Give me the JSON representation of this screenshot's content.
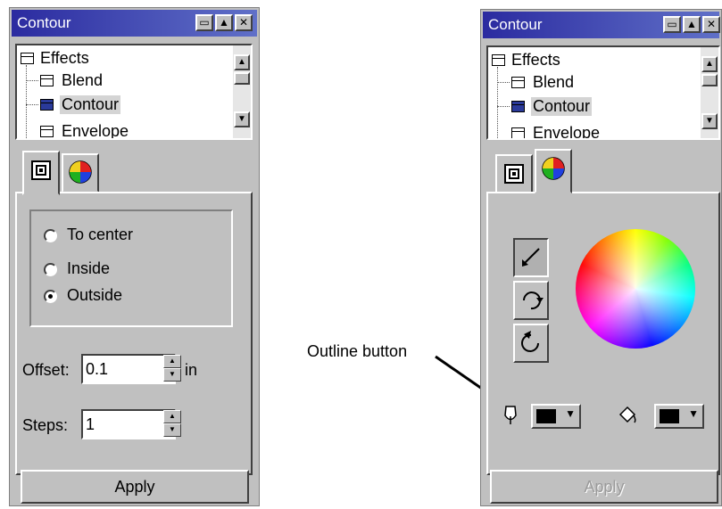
{
  "left": {
    "title": "Contour",
    "tree": {
      "root": "Effects",
      "items": [
        "Blend",
        "Contour",
        "Envelope"
      ]
    },
    "options": [
      "To center",
      "Inside",
      "Outside"
    ],
    "selected_option": "Outside",
    "offset": {
      "label": "Offset:",
      "value": "0.1",
      "unit": "in"
    },
    "steps": {
      "label": "Steps:",
      "value": "1"
    },
    "apply_label": "Apply"
  },
  "right": {
    "title": "Contour",
    "tree": {
      "root": "Effects",
      "items": [
        "Blend",
        "Contour",
        "Envelope"
      ]
    },
    "apply_label": "Apply"
  },
  "annotation": {
    "label": "Outline button"
  },
  "colors": {
    "titlebar": "#2b2ba0",
    "panel": "#c0c0c0",
    "swatch": "#000000"
  }
}
